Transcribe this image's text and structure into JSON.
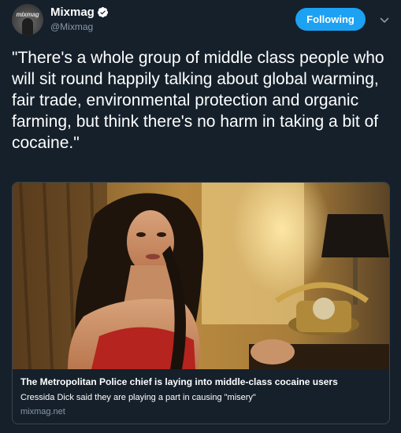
{
  "author": {
    "display_name": "Mixmag",
    "handle": "@Mixmag",
    "avatar_text": "mixmag",
    "verified": true
  },
  "actions": {
    "follow_label": "Following",
    "menu_icon": "chevron-down-icon"
  },
  "tweet": {
    "text": "\"There's a whole group of middle class people who will sit round happily talking about global warming, fair trade, environmental protection and organic farming, but think there's no harm in taking a bit of cocaine.\""
  },
  "card": {
    "title": "The Metropolitan Police chief is laying into middle-class cocaine users",
    "description": "Cressida Dick said they are playing a part in causing \"misery\"",
    "domain": "mixmag.net"
  },
  "colors": {
    "background": "#15202b",
    "accent": "#1da1f2",
    "secondary_text": "#8899a6",
    "border": "#38444d"
  }
}
